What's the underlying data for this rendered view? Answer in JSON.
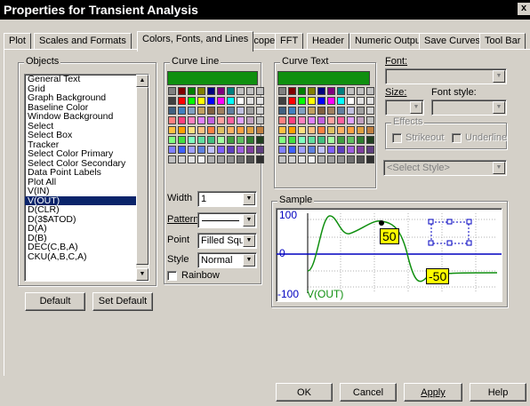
{
  "window": {
    "title": "Properties for Transient Analysis",
    "close": "x"
  },
  "tabs": [
    {
      "label": "Plot"
    },
    {
      "label": "Scales and Formats"
    },
    {
      "label": "Colors, Fonts, and Lines"
    },
    {
      "label": "Scope"
    },
    {
      "label": "FFT"
    },
    {
      "label": "Header"
    },
    {
      "label": "Numeric Output"
    },
    {
      "label": "Save Curves"
    },
    {
      "label": "Tool Bar"
    }
  ],
  "objects": {
    "title": "Objects",
    "items": [
      "General Text",
      "Grid",
      "Graph Background",
      "Baseline Color",
      "Window Background",
      "Select",
      "Select Box",
      "Tracker",
      "Select Color Primary",
      "Select Color Secondary",
      "Data Point Labels",
      "Plot All",
      "V(IN)",
      "V(OUT)",
      "D(CLR)",
      "D(3$ATOD)",
      "D(A)",
      "D(B)",
      "DEC(C,B,A)",
      "CKU(A,B,C,A)"
    ],
    "selected": "V(OUT)",
    "default_button": "Default",
    "set_default_button": "Set Default"
  },
  "curve_line": {
    "title": "Curve Line",
    "color": "#0f8f0f",
    "width_label": "Width",
    "width_value": "1",
    "pattern_label": "Pattern",
    "point_label": "Point",
    "point_value": "Filled Squa",
    "style_label": "Style",
    "style_value": "Normal",
    "rainbow_label": "Rainbow"
  },
  "curve_text": {
    "title": "Curve Text",
    "color": "#0f8f0f"
  },
  "palette": [
    "#808080",
    "#800000",
    "#008000",
    "#808000",
    "#000080",
    "#800080",
    "#008080",
    "#c0c0c0",
    "#c0c0c0",
    "#c0c0c0",
    "#404040",
    "#ff0000",
    "#00ff00",
    "#ffff00",
    "#0000ff",
    "#ff00ff",
    "#00ffff",
    "#ffffff",
    "#e0e0e0",
    "#e0e0e0",
    "#406080",
    "#4080c0",
    "#80a0c0",
    "#c0a060",
    "#806040",
    "#a08060",
    "#6080a0",
    "#c0c0e0",
    "#a0a0a0",
    "#d0d0d0",
    "#ff8080",
    "#ff4080",
    "#ff80c0",
    "#e080ff",
    "#c060e0",
    "#ffa0a0",
    "#ff60a0",
    "#e0a0ff",
    "#c0a0c0",
    "#c0c0c0",
    "#ffc040",
    "#ffa000",
    "#ffe080",
    "#ffc080",
    "#ff8040",
    "#e0c060",
    "#ffb060",
    "#ffa040",
    "#e0a040",
    "#c08040",
    "#80ff80",
    "#40e040",
    "#80ffc0",
    "#60e0a0",
    "#40c080",
    "#a0ffa0",
    "#40a040",
    "#60c060",
    "#308030",
    "#204020",
    "#8080ff",
    "#4060ff",
    "#a0a0ff",
    "#6080e0",
    "#c0c0ff",
    "#8060ff",
    "#6040c0",
    "#a060e0",
    "#8040a0",
    "#604080",
    "#c0c0c0",
    "#d0d0d0",
    "#e0e0e0",
    "#f0f0f0",
    "#b0b0b0",
    "#a0a0a0",
    "#909090",
    "#707070",
    "#505050",
    "#303030"
  ],
  "font": {
    "font_label": "Font:",
    "size_label": "Size:",
    "style_label": "Font style:",
    "effects_title": "Effects",
    "strikeout_label": "Strikeout",
    "underline_label": "Underline",
    "style_select": "<Select Style>"
  },
  "sample": {
    "title": "Sample",
    "y_top": "100",
    "y_mid": "0",
    "y_bottom": "-100",
    "series_label": "V(OUT)",
    "tag_top": "50",
    "tag_bottom": "-50"
  },
  "footer": {
    "ok": "OK",
    "cancel": "Cancel",
    "apply": "Apply",
    "help": "Help"
  },
  "colors": {
    "selection": "#0a246a",
    "curve": "#0f8f0f",
    "axis_text": "#0000c0",
    "tag_bg": "#ffff00"
  }
}
